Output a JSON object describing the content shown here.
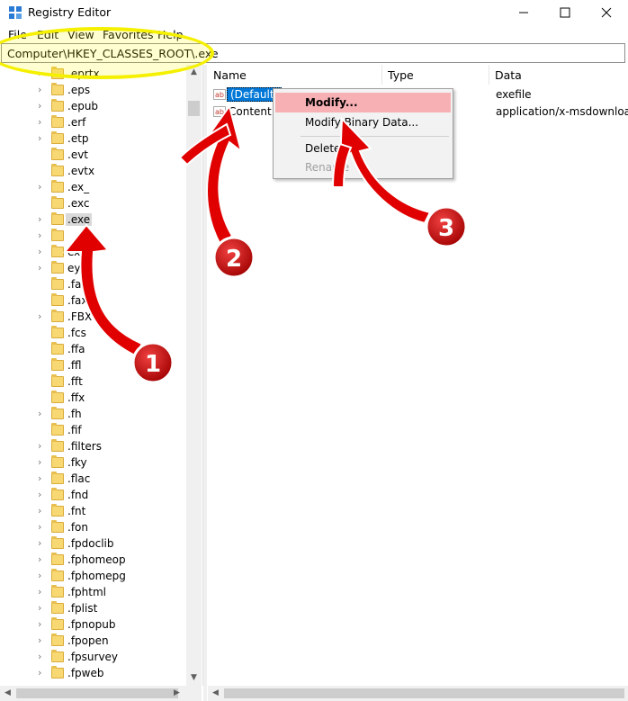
{
  "window": {
    "title": "Registry Editor",
    "minimize": "—",
    "maximize": "☐",
    "close": "✕"
  },
  "menu": [
    "File",
    "Edit",
    "View",
    "Favorites",
    "Help"
  ],
  "address": "Computer\\HKEY_CLASSES_ROOT\\.exe",
  "tree": {
    "items": [
      {
        "label": ".eprtx",
        "expandable": true
      },
      {
        "label": ".eps",
        "expandable": true
      },
      {
        "label": ".epub",
        "expandable": true
      },
      {
        "label": ".erf",
        "expandable": true
      },
      {
        "label": ".etp",
        "expandable": true
      },
      {
        "label": ".evt",
        "expandable": false
      },
      {
        "label": ".evtx",
        "expandable": false
      },
      {
        "label": ".ex_",
        "expandable": true
      },
      {
        "label": ".exc",
        "expandable": false
      },
      {
        "label": ".exe",
        "expandable": true,
        "selected": true
      },
      {
        "label": "",
        "expandable": true
      },
      {
        "label": "ext",
        "expandable": true
      },
      {
        "label": "ey",
        "expandable": true
      },
      {
        "label": ".faq",
        "expandable": false
      },
      {
        "label": ".fax",
        "expandable": false
      },
      {
        "label": ".FBX",
        "expandable": true
      },
      {
        "label": ".fcs",
        "expandable": false
      },
      {
        "label": ".ffa",
        "expandable": false
      },
      {
        "label": ".ffl",
        "expandable": false
      },
      {
        "label": ".fft",
        "expandable": false
      },
      {
        "label": ".ffx",
        "expandable": false
      },
      {
        "label": ".fh",
        "expandable": true
      },
      {
        "label": ".fif",
        "expandable": false
      },
      {
        "label": ".filters",
        "expandable": true
      },
      {
        "label": ".fky",
        "expandable": true
      },
      {
        "label": ".flac",
        "expandable": true
      },
      {
        "label": ".fnd",
        "expandable": true
      },
      {
        "label": ".fnt",
        "expandable": true
      },
      {
        "label": ".fon",
        "expandable": true
      },
      {
        "label": ".fpdoclib",
        "expandable": true
      },
      {
        "label": ".fphomeop",
        "expandable": true
      },
      {
        "label": ".fphomepg",
        "expandable": true
      },
      {
        "label": ".fphtml",
        "expandable": true
      },
      {
        "label": ".fplist",
        "expandable": true
      },
      {
        "label": ".fpnopub",
        "expandable": true
      },
      {
        "label": ".fpopen",
        "expandable": true
      },
      {
        "label": ".fpsurvey",
        "expandable": true
      },
      {
        "label": ".fpweb",
        "expandable": true
      }
    ]
  },
  "list": {
    "columns": [
      "Name",
      "Type",
      "Data"
    ],
    "rows": [
      {
        "icon": "ab",
        "name": "(Default)",
        "type": "",
        "data": "exefile",
        "selected": true
      },
      {
        "icon": "ab",
        "name": "Content T",
        "type": "",
        "data": "application/x-msdownload",
        "selected": false
      }
    ]
  },
  "context_menu": {
    "items": [
      {
        "label": "Modify...",
        "bold": true,
        "hover": true,
        "disabled": false
      },
      {
        "label": "Modify Binary Data...",
        "bold": false,
        "hover": false,
        "disabled": false
      },
      {
        "label": "Delete",
        "bold": false,
        "hover": false,
        "disabled": false
      },
      {
        "label": "Rename",
        "bold": false,
        "hover": false,
        "disabled": true
      }
    ]
  },
  "annotations": {
    "badges": [
      "1",
      "2",
      "3"
    ],
    "arrow_color": "#e00000",
    "highlight_color": "#f5f000"
  }
}
